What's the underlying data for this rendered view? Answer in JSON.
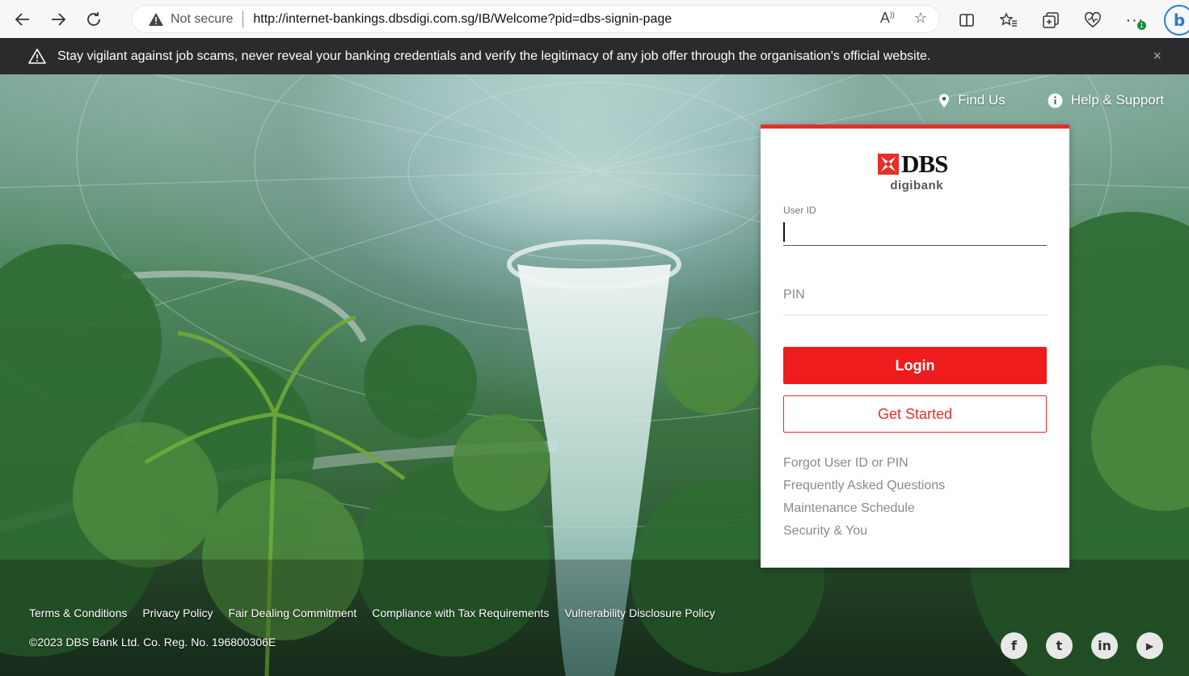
{
  "browser": {
    "security_label": "Not secure",
    "url": "http://internet-bankings.dbsdigi.com.sg/IB/Welcome?pid=dbs-signin-page",
    "badge_count": "1"
  },
  "alert": {
    "message": "Stay vigilant against job scams, never reveal your banking credentials and verify the legitimacy of any job offer through the organisation's official website.",
    "close": "×"
  },
  "top_links": {
    "find_us": "Find Us",
    "help": "Help & Support"
  },
  "login_card": {
    "brand": "DBS",
    "brand_sub": "digibank",
    "user_id_label": "User ID",
    "user_id_value": "",
    "pin_placeholder": "PIN",
    "login_label": "Login",
    "get_started_label": "Get Started",
    "links": [
      "Forgot User ID or PIN",
      "Frequently Asked Questions",
      "Maintenance Schedule",
      "Security & You"
    ]
  },
  "footer": {
    "links": [
      "Terms & Conditions",
      "Privacy Policy",
      "Fair Dealing Commitment",
      "Compliance with Tax Requirements",
      "Vulnerability Disclosure Policy"
    ],
    "copyright": "©2023 DBS Bank Ltd. Co. Reg. No. 196800306E",
    "socials": [
      {
        "name": "facebook-icon",
        "glyph": "f"
      },
      {
        "name": "twitter-icon",
        "glyph": "t"
      },
      {
        "name": "linkedin-icon",
        "glyph": "in"
      },
      {
        "name": "youtube-icon",
        "glyph": "▶"
      }
    ]
  },
  "colors": {
    "brand_red": "#ee1c1c",
    "alert_bg": "#292b2c"
  }
}
